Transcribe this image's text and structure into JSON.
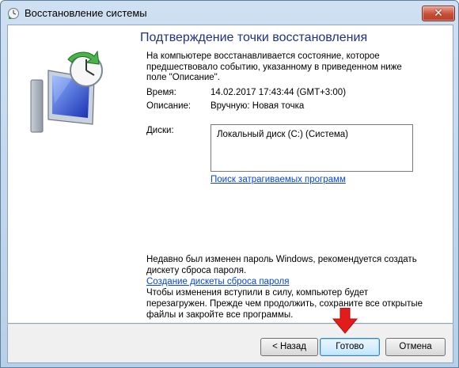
{
  "window": {
    "title": "Восстановление системы",
    "close_symbol": "✕"
  },
  "page": {
    "heading": "Подтверждение точки восстановления",
    "intro": "На компьютере восстанавливается состояние, которое предшествовало событию, указанному в приведенном ниже поле \"Описание\"."
  },
  "details": {
    "time_label": "Время:",
    "time_value": "14.02.2017 17:43:44 (GMT+3:00)",
    "description_label": "Описание:",
    "description_value": "Вручную: Новая точка",
    "disks_label": "Диски:",
    "disks": [
      "Локальный диск (C:) (Система)"
    ],
    "scan_link": "Поиск затрагиваемых программ"
  },
  "password_notice": {
    "text": "Недавно был изменен пароль Windows, рекомендуется создать дискету сброса пароля.",
    "link": "Создание дискеты сброса пароля"
  },
  "restart_notice": "Чтобы изменения вступили в силу, компьютер будет перезагружен. Прежде чем продолжить, сохраните все открытые файлы и закройте все программы.",
  "buttons": {
    "back": "< Назад",
    "finish": "Готово",
    "cancel": "Отмена"
  },
  "icons": {
    "title_icon": "system-restore-icon",
    "hero_icon": "system-restore-clock-monitor-icon",
    "arrow": "red-arrow-down-icon"
  },
  "colors": {
    "heading": "#1e3287",
    "link": "#0645d6",
    "arrow": "#e21b1b"
  }
}
